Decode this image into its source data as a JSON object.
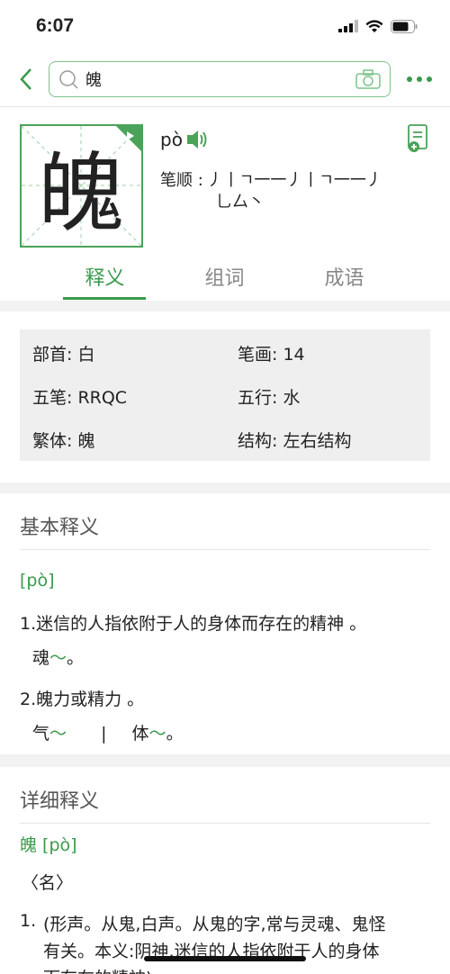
{
  "status": {
    "time": "6:07"
  },
  "search": {
    "query": "魄"
  },
  "character": {
    "glyph": "魄",
    "pinyin": "pò",
    "strokes_label": "笔顺 :",
    "strokes_line1": "丿丨ㄱ一一丿丨ㄱ一一丿",
    "strokes_line2": "乚厶丶"
  },
  "tabs": [
    {
      "label": "释义"
    },
    {
      "label": "组词"
    },
    {
      "label": "成语"
    }
  ],
  "info": {
    "radical": "部首: 白",
    "stroke_count": "笔画: 14",
    "wubi": "五笔: RRQC",
    "wuxing": "五行: 水",
    "traditional": "繁体: 魄",
    "structure": "结构: 左右结构"
  },
  "basic": {
    "title": "基本释义",
    "pinyin": "[pò]",
    "def1": "1.迷信的人指依附于人的身体而存在的精神 。",
    "ex1_pre": "魂",
    "ex1_tilde": "～",
    "ex1_post": "。",
    "def2": "2.魄力或精力 。",
    "ex2a_pre": "气",
    "ex2a_tilde": "～",
    "ex2_sep": "|",
    "ex2b_pre": "体",
    "ex2b_tilde": "～",
    "ex2b_post": "。"
  },
  "detail": {
    "title": "详细释义",
    "char_pinyin": "魄 [pò]",
    "pos": "〈名〉",
    "num": "1.",
    "line1": "(形声。从鬼,白声。从鬼的字,常与灵魂、鬼怪",
    "line2": "有关。本义:阴神,迷信的人指依附于人的身体",
    "line3": "而存在的精神)"
  },
  "colors": {
    "accent": "#3a9a4c",
    "border": "#7cc38a"
  }
}
